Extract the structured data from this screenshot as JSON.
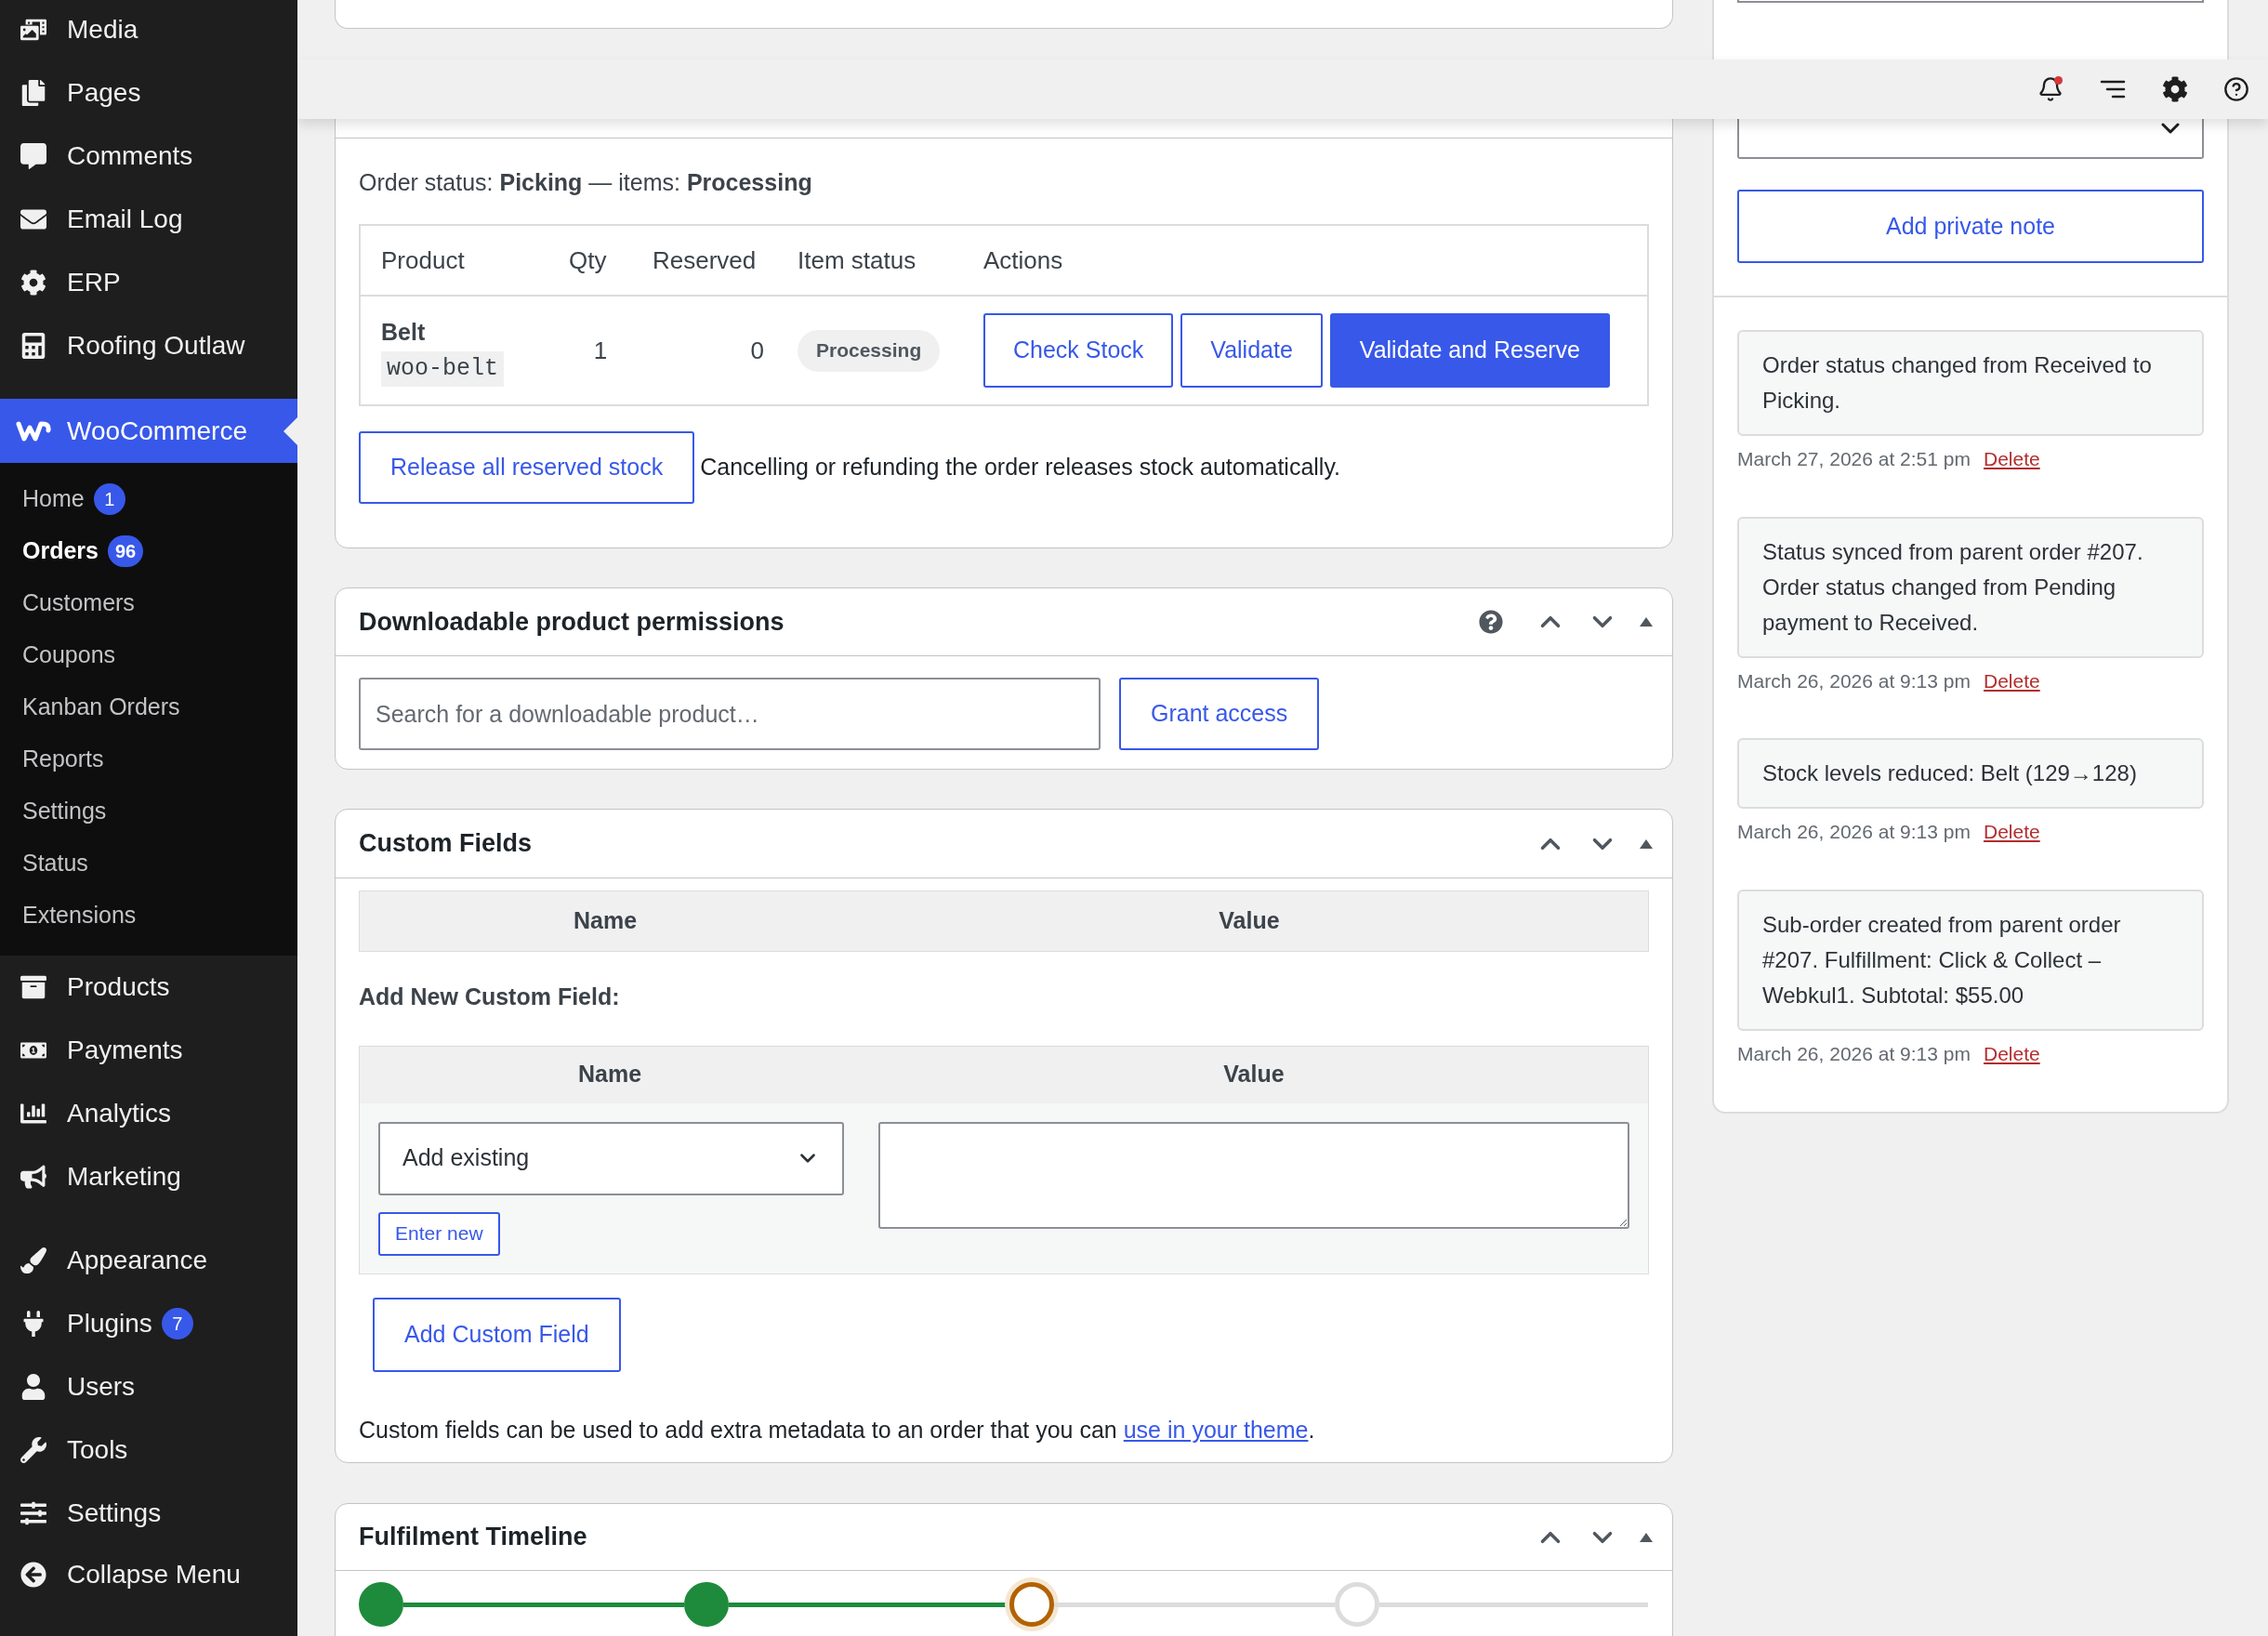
{
  "sidebar": {
    "items_top": [
      {
        "label": "Media"
      },
      {
        "label": "Pages"
      },
      {
        "label": "Comments"
      },
      {
        "label": "Email Log"
      },
      {
        "label": "ERP"
      },
      {
        "label": "Roofing Outlaw"
      }
    ],
    "current": {
      "label": "WooCommerce",
      "selected": true
    },
    "submenu": [
      {
        "label": "Home",
        "selected": false,
        "badge": "1"
      },
      {
        "label": "Orders",
        "selected": true,
        "badge": "96"
      },
      {
        "label": "Customers",
        "selected": false
      },
      {
        "label": "Coupons",
        "selected": false
      },
      {
        "label": "Kanban Orders",
        "selected": false
      },
      {
        "label": "Reports",
        "selected": false
      },
      {
        "label": "Settings",
        "selected": false
      },
      {
        "label": "Status",
        "selected": false
      },
      {
        "label": "Extensions",
        "selected": false
      }
    ],
    "items_middle": [
      {
        "label": "Products"
      },
      {
        "label": "Payments"
      },
      {
        "label": "Analytics"
      },
      {
        "label": "Marketing"
      }
    ],
    "items_bottom": [
      {
        "label": "Appearance"
      },
      {
        "label": "Plugins",
        "badge": "7"
      },
      {
        "label": "Users"
      },
      {
        "label": "Tools"
      },
      {
        "label": "Settings"
      }
    ],
    "collapse": {
      "label": "Collapse Menu"
    }
  },
  "toolbar": {
    "notifications_unread": true
  },
  "order_panel": {
    "status_line": "Order status: **Picking** — items: **Processing**",
    "columns": [
      "Product",
      "Qty",
      "Reserved",
      "Item status",
      "Actions"
    ],
    "rows": [
      {
        "product": "Belt",
        "sku": "woo-belt",
        "qty": "1",
        "reserved": "0",
        "status": "Processing",
        "actions": [
          {
            "label": "Check Stock",
            "primary": false
          },
          {
            "label": "Validate",
            "primary": false
          },
          {
            "label": "Validate and Reserve",
            "primary": true
          }
        ]
      }
    ],
    "release_button": "Release all reserved stock",
    "note": "Cancelling or refunding the order releases stock automatically."
  },
  "downloads": {
    "title": "Downloadable product permissions",
    "search": {
      "placeholder": "Search for a downloadable product…"
    },
    "button": "Grant access"
  },
  "custom_fields": {
    "title": "Custom Fields",
    "columns": [
      "Name",
      "Value"
    ],
    "add_title": "Add New Custom Field:",
    "add_columns": [
      "Name",
      "Value"
    ],
    "select": {
      "value": "Add existing"
    },
    "enter_new": "Enter new",
    "add_button": "Add Custom Field",
    "help": {
      "text": "Custom fields can be used to add extra metadata to an order that you can ",
      "link": "use in your theme",
      "end": "."
    }
  },
  "timeline": {
    "title": "Fulfilment Timeline",
    "steps": [
      {
        "kind": "done"
      },
      {
        "kind": "done"
      },
      {
        "kind": "current"
      },
      {
        "kind": "pending"
      }
    ]
  },
  "notes_panel": {
    "add_button": "Add private note",
    "notes": [
      {
        "text": "Order status changed from Received to Picking.",
        "date": "March 27, 2026 at 2:51 pm",
        "delete": "Delete"
      },
      {
        "text": "Status synced from parent order #207. Order status changed from Pending payment to Received.",
        "date": "March 26, 2026 at 9:13 pm",
        "delete": "Delete"
      },
      {
        "text": "Stock levels reduced: Belt (129→128)",
        "date": "March 26, 2026 at 9:13 pm",
        "delete": "Delete"
      },
      {
        "text": "Sub-order created from parent order #207. Fulfillment: Click & Collect – Webkul1. Subtotal: $55.00",
        "date": "March 26, 2026 at 9:13 pm",
        "delete": "Delete"
      }
    ]
  }
}
